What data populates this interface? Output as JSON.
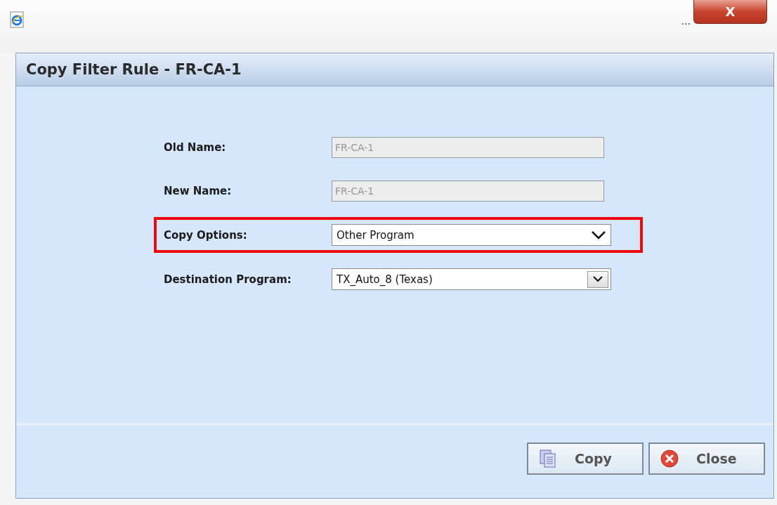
{
  "window": {
    "title_bar_text": "...",
    "close_label": "X"
  },
  "dialog": {
    "title": "Copy Filter Rule - FR-CA-1"
  },
  "fields": [
    {
      "label": "Old Name:",
      "kind": "text",
      "value": "FR-CA-1",
      "disabled": true,
      "highlighted": false
    },
    {
      "label": "New Name:",
      "kind": "text",
      "value": "FR-CA-1",
      "disabled": true,
      "highlighted": false
    },
    {
      "label": "Copy Options:",
      "kind": "dropdown",
      "value": "Other Program",
      "disabled": false,
      "highlighted": true
    },
    {
      "label": "Destination Program:",
      "kind": "combo",
      "value": "TX_Auto_8 (Texas)",
      "disabled": false,
      "highlighted": false
    }
  ],
  "buttons": [
    {
      "label": "Copy",
      "kind": "copy"
    },
    {
      "label": "Close",
      "kind": "close"
    }
  ]
}
